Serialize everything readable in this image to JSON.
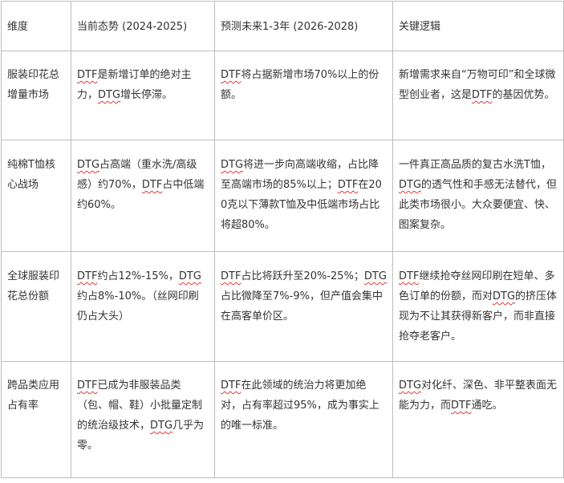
{
  "table": {
    "headers": [
      "维度",
      "当前态势 (2024-2025)",
      "预测未来1-3年 (2026-2028)",
      "关键逻辑"
    ],
    "rows": [
      {
        "dimension": "服装印花总增量市场",
        "current": [
          {
            "t": "DTF",
            "u": true
          },
          {
            "t": "是新增订单的绝对主力，"
          },
          {
            "t": "DTG",
            "u": true
          },
          {
            "t": "增长停滞。"
          }
        ],
        "forecast": [
          {
            "t": "DTF",
            "u": true
          },
          {
            "t": "将占据新增市场70%以上的份额。"
          }
        ],
        "logic": [
          {
            "t": "新增需求来自“万物可印”和全球微型创业者，这是"
          },
          {
            "t": "DTF",
            "u": true
          },
          {
            "t": "的基因优势。"
          }
        ]
      },
      {
        "dimension": "纯棉T恤核心战场",
        "current": [
          {
            "t": "DTG",
            "u": true
          },
          {
            "t": "占高端（重水洗/高级感）约70%，"
          },
          {
            "t": "DTF",
            "u": true
          },
          {
            "t": "占中低端约60%。"
          }
        ],
        "forecast": [
          {
            "t": "DTG",
            "u": true
          },
          {
            "t": "将进一步向高端收缩，占比降至高端市场的85%以上；"
          },
          {
            "t": "DTF",
            "u": true
          },
          {
            "t": "在200克以下薄款T恤及中低端市场占比将超80%。"
          }
        ],
        "logic": [
          {
            "t": "一件真正高品质的复古水洗T恤，"
          },
          {
            "t": "DTG",
            "u": true
          },
          {
            "t": "的透气性和手感无法替代，但此类市场很小。大众要便宜、快、图案复杂。"
          }
        ]
      },
      {
        "dimension": "全球服装印花总份额",
        "current": [
          {
            "t": "DTF",
            "u": true
          },
          {
            "t": "约占12%-15%，"
          },
          {
            "t": "DTG",
            "u": true
          },
          {
            "t": "约占8%-10%。（丝网印刷仍占大头）"
          }
        ],
        "forecast": [
          {
            "t": "DTF",
            "u": true
          },
          {
            "t": "占比将跃升至20%-25%；"
          },
          {
            "t": "DTG",
            "u": true
          },
          {
            "t": "占比微降至7%-9%，但产值会集中在高客单价区。"
          }
        ],
        "logic": [
          {
            "t": "DTF",
            "u": true
          },
          {
            "t": "继续抢夺丝网印刷在短单、多色订单的份额，而对"
          },
          {
            "t": "DTG",
            "u": true
          },
          {
            "t": "的挤压体现为不让其获得新客户，而非直接抢夺老客户。"
          }
        ]
      },
      {
        "dimension": "跨品类应用占有率",
        "current": [
          {
            "t": "DTF",
            "u": true
          },
          {
            "t": "已成为非服装品类（包、帽、鞋）小批量定制的统治级技术，"
          },
          {
            "t": "DTG",
            "u": true
          },
          {
            "t": "几乎为零。"
          }
        ],
        "forecast": [
          {
            "t": "DTF",
            "u": true
          },
          {
            "t": "在此领域的统治力将更加绝对，占有率超过95%，成为事实上的唯一标准。"
          }
        ],
        "logic": [
          {
            "t": "DTG",
            "u": true
          },
          {
            "t": "对化纤、深色、非平整表面无能为力，而"
          },
          {
            "t": "DTF",
            "u": true
          },
          {
            "t": "通吃。"
          }
        ]
      }
    ]
  }
}
